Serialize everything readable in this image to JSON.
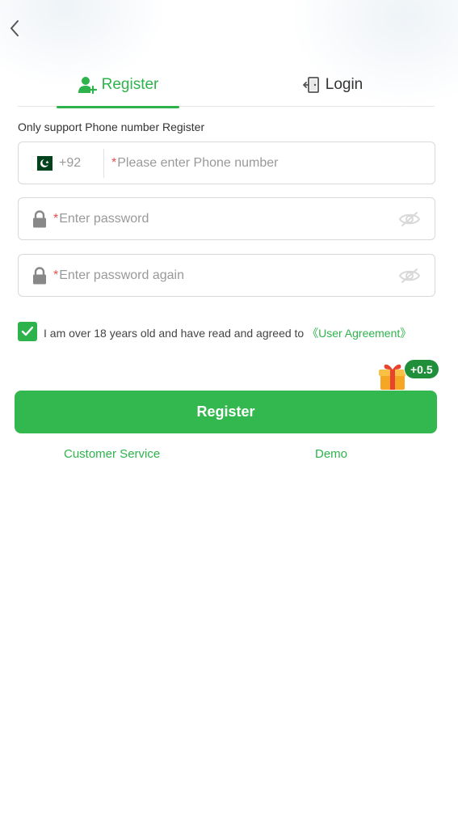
{
  "nav": {
    "back_icon": "chevron-left-icon"
  },
  "tabs": [
    {
      "label": "Register",
      "icon": "user-add-icon",
      "active": true
    },
    {
      "label": "Login",
      "icon": "door-exit-icon",
      "active": false
    }
  ],
  "form": {
    "hint": "Only support Phone number Register",
    "phone": {
      "country_flag": "pakistan-flag-icon",
      "country_code": "+92",
      "required_mark": "*",
      "placeholder": "Please enter Phone number",
      "value": ""
    },
    "password": {
      "required_mark": "*",
      "placeholder": "Enter password",
      "value": ""
    },
    "password_again": {
      "required_mark": "*",
      "placeholder": "Enter password again",
      "value": ""
    },
    "agreement": {
      "checked": true,
      "text": "I am over 18 years old and have read and agreed to ",
      "link": "《User Agreement》"
    },
    "submit_label": "Register",
    "bonus_badge": "+0.5"
  },
  "footer": {
    "customer_service": "Customer Service",
    "demo": "Demo"
  },
  "colors": {
    "accent": "#2eb34c",
    "required": "#e65050",
    "bonus_badge": "#1f8f3a"
  }
}
